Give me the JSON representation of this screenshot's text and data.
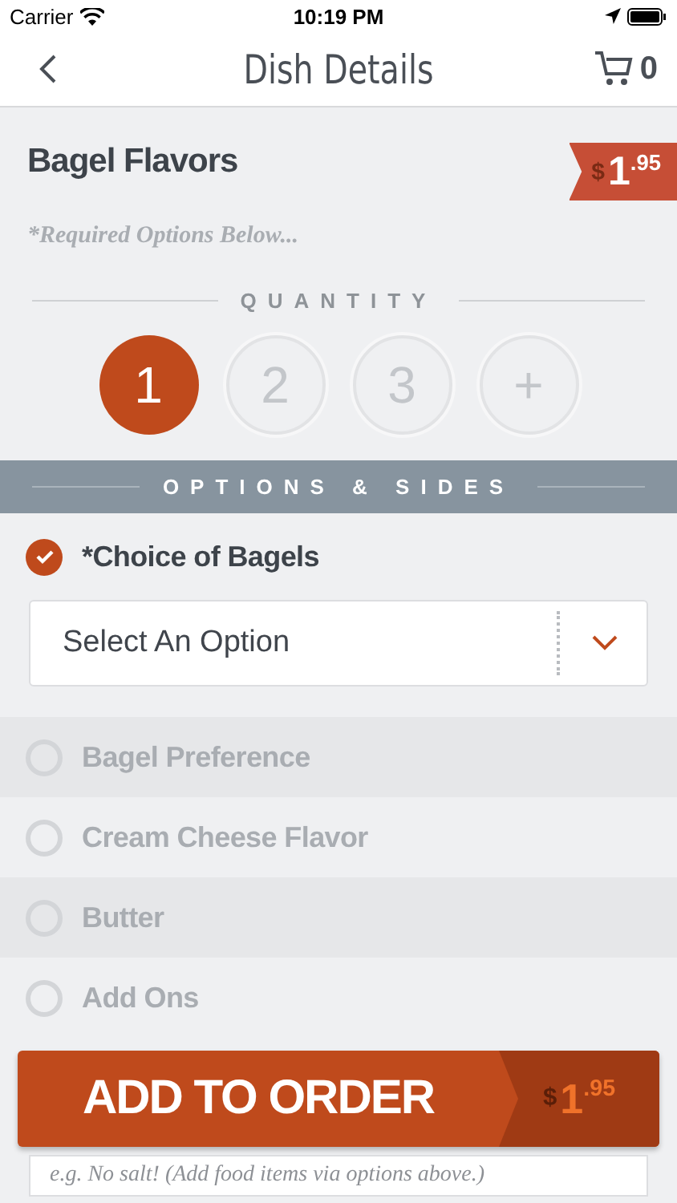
{
  "status_bar": {
    "carrier": "Carrier",
    "time": "10:19 PM"
  },
  "nav": {
    "title": "Dish Details",
    "cart_count": "0"
  },
  "dish": {
    "name": "Bagel Flavors",
    "note": "*Required Options Below...",
    "price": {
      "currency": "$",
      "amount": "1",
      "cents": ".95"
    }
  },
  "quantity": {
    "heading": "QUANTITY",
    "options": [
      {
        "label": "1",
        "selected": true
      },
      {
        "label": "2",
        "selected": false
      },
      {
        "label": "3",
        "selected": false
      },
      {
        "label": "+",
        "selected": false
      }
    ]
  },
  "options_heading": "OPTIONS & SIDES",
  "option_groups": [
    {
      "label": "*Choice of Bagels",
      "checked": true,
      "select": {
        "placeholder": "Select An Option"
      }
    },
    {
      "label": "Bagel Preference",
      "checked": false
    },
    {
      "label": "Cream Cheese Flavor",
      "checked": false
    },
    {
      "label": "Butter",
      "checked": false
    },
    {
      "label": "Add Ons",
      "checked": false
    }
  ],
  "notes": {
    "placeholder": "e.g. No salt! (Add food items via options above.)"
  },
  "add_button": {
    "label": "ADD TO ORDER",
    "price": {
      "currency": "$",
      "amount": "1",
      "cents": ".95"
    }
  }
}
